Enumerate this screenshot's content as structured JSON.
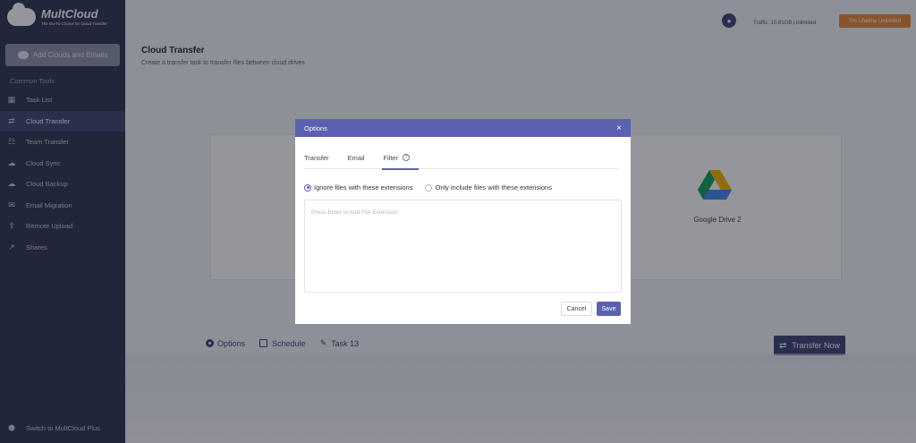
{
  "brand": {
    "name": "MultCloud",
    "tagline": "The Go-To Choice for Cloud Transfer"
  },
  "sidebar": {
    "add_button": "Add Clouds and Emails",
    "section_label": "Common Tools",
    "items": [
      {
        "label": "Task List",
        "icon": "grid-icon"
      },
      {
        "label": "Cloud Transfer",
        "icon": "transfer-icon",
        "active": true
      },
      {
        "label": "Team Transfer",
        "icon": "team-icon"
      },
      {
        "label": "Cloud Sync",
        "icon": "sync-icon"
      },
      {
        "label": "Cloud Backup",
        "icon": "backup-icon"
      },
      {
        "label": "Email Migration",
        "icon": "email-icon"
      },
      {
        "label": "Remote Upload",
        "icon": "upload-icon"
      },
      {
        "label": "Shares",
        "icon": "share-icon"
      }
    ],
    "footer": "Switch to MultCloud Plus"
  },
  "header": {
    "traffic": "Traffic: 10.81GB,Unlimited",
    "upgrade": "5% Lifetime Unlimited"
  },
  "main": {
    "title": "Cloud Transfer",
    "subtitle": "Create a transfer task to transfer files between cloud drives",
    "target_label": "Google Drive 2",
    "options": "Options",
    "schedule": "Schedule",
    "task": "Task 13",
    "transfer_now": "Transfer Now"
  },
  "modal": {
    "title": "Options",
    "close": "×",
    "tabs": [
      "Transfer",
      "Email",
      "Filter"
    ],
    "active_tab": "Filter",
    "radio_ignore": "Ignore files with these extensions",
    "radio_include": "Only include files with these extensions",
    "placeholder": "Press Enter to Add File Extension",
    "cancel": "Cancel",
    "save": "Save"
  },
  "colors": {
    "sidebar": "#2c3350",
    "accent": "#5b61b0",
    "upgrade": "#e78734"
  }
}
